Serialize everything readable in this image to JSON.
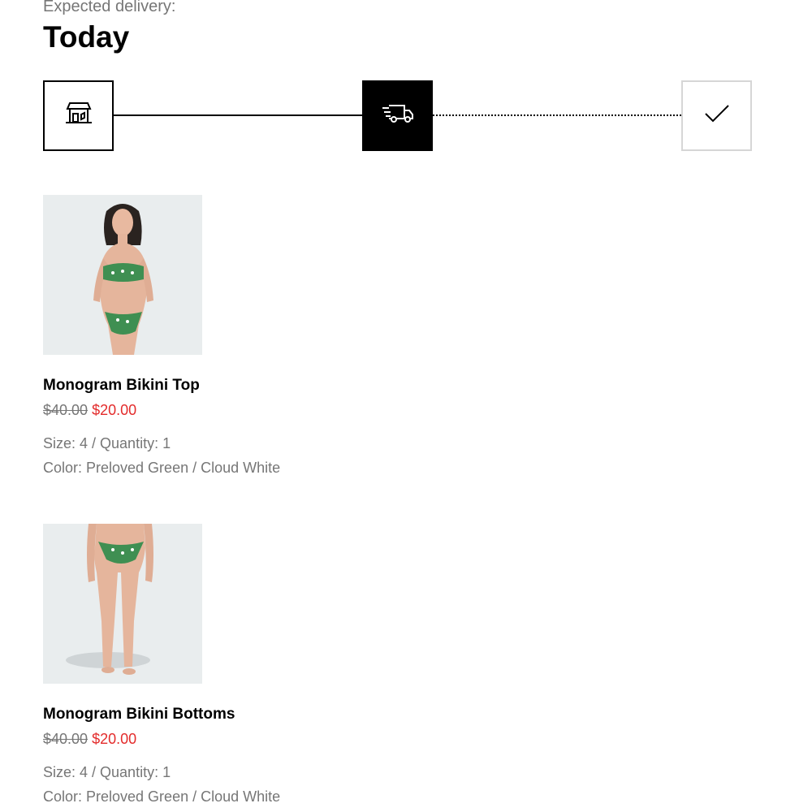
{
  "delivery": {
    "label": "Expected delivery:",
    "value": "Today"
  },
  "tracker": {
    "steps": [
      {
        "icon": "store-icon",
        "state": "done"
      },
      {
        "icon": "delivery-truck-icon",
        "state": "current"
      },
      {
        "icon": "checkmark-icon",
        "state": "upcoming"
      }
    ]
  },
  "products": [
    {
      "name": "Monogram Bikini Top",
      "original_price": "$40.00",
      "sale_price": "$20.00",
      "size_quantity": "Size: 4 / Quantity: 1",
      "color": "Color: Preloved Green / Cloud White"
    },
    {
      "name": "Monogram Bikini Bottoms",
      "original_price": "$40.00",
      "sale_price": "$20.00",
      "size_quantity": "Size: 4 / Quantity: 1",
      "color": "Color: Preloved Green / Cloud White"
    }
  ],
  "colors": {
    "sale": "#e32b2b",
    "muted": "#767676",
    "image_bg": "#e9edee",
    "swimwear_green": "#3f8f52"
  }
}
